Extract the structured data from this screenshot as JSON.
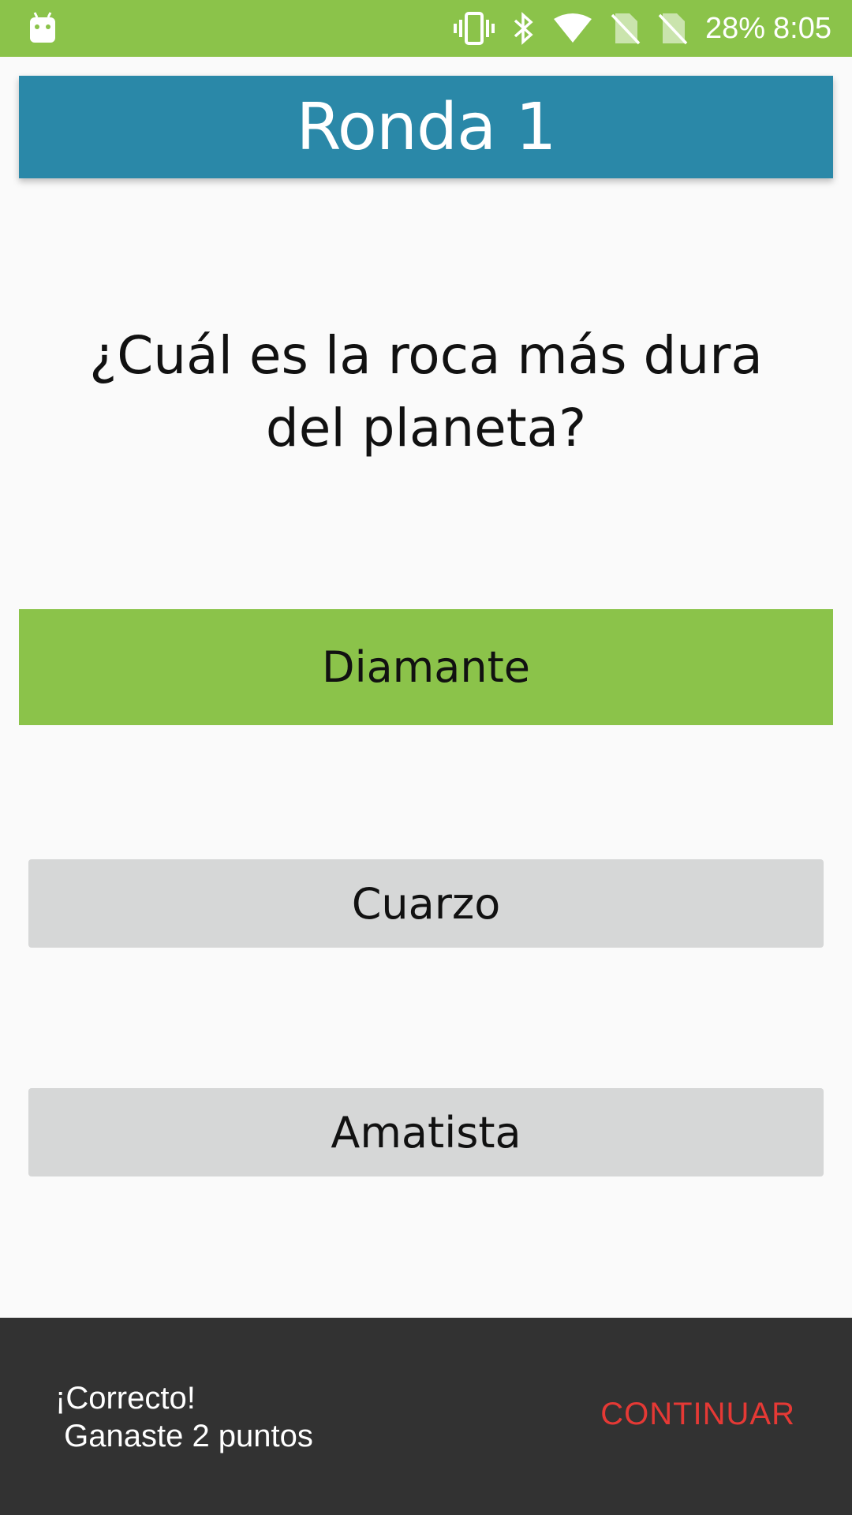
{
  "status_bar": {
    "battery": "28%",
    "time": "8:05",
    "icons": [
      "android-icon",
      "vibrate-icon",
      "bluetooth-icon",
      "wifi-icon",
      "no-sim-icon",
      "no-sim-icon"
    ]
  },
  "header": {
    "title": "Ronda 1"
  },
  "question": {
    "text": "¿Cuál es la roca más dura del planeta?"
  },
  "answers": [
    {
      "label": "Diamante"
    },
    {
      "label": "Cuarzo"
    },
    {
      "label": "Amatista"
    }
  ],
  "snackbar": {
    "message": "¡Correcto!\n Ganaste 2 puntos",
    "action": "CONTINUAR"
  },
  "colors": {
    "status_bar": "#8bc34a",
    "header": "#2a88a8",
    "correct": "#8bc34a",
    "option": "#d6d7d7",
    "snackbar": "#323232",
    "action": "#e53935"
  }
}
